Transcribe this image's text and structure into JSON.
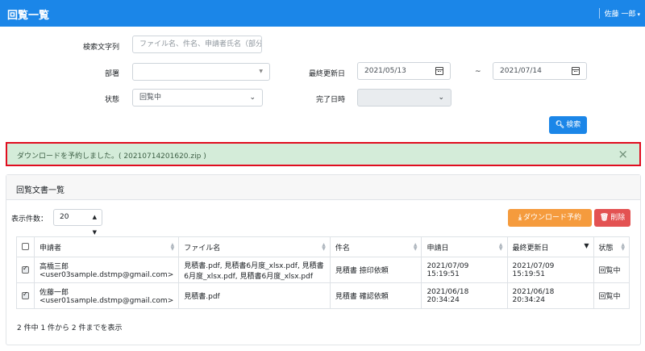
{
  "header": {
    "title": "回覧一覧",
    "user": "佐藤 一郎",
    "user_caret": "▾"
  },
  "search": {
    "keyword_label": "検索文字列",
    "keyword_placeholder": "ファイル名、件名、申請者氏名（部分",
    "dept_label": "部署",
    "dept_value": "",
    "last_updated_label": "最終更新日",
    "date_from": "2021/05/13",
    "date_sep": "~",
    "date_to": "2021/07/14",
    "status_label": "状態",
    "status_value": "回覧中",
    "completed_label": "完了日時",
    "completed_value": "",
    "search_button": "検索",
    "search_icon": "search-icon"
  },
  "alert": {
    "message": "ダウンロードを予約しました。( 20210714201620.zip )",
    "close": "×"
  },
  "list": {
    "title": "回覧文書一覧",
    "per_page_label": "表示件数：",
    "per_page_value": "20",
    "download_button": "ダウンロード予約",
    "delete_button": "削除",
    "columns": [
      "",
      "申請者",
      "ファイル名",
      "件名",
      "申請日",
      "最終更新日",
      "状態"
    ],
    "rows": [
      {
        "checked": true,
        "applicant_name": "高橋三郎",
        "applicant_email": "<user03sample.dstmp@gmail.com>",
        "file": "見積書.pdf, 見積書6月度_xlsx.pdf, 見積書6月度_xlsx.pdf, 見積書6月度_xlsx.pdf",
        "subject": "見積書 捺印依頼",
        "applied": "2021/07/09 15:19:51",
        "updated": "2021/07/09 15:19:51",
        "status": "回覧中"
      },
      {
        "checked": true,
        "applicant_name": "佐藤一郎",
        "applicant_email": "<user01sample.dstmp@gmail.com>",
        "file": "見積書.pdf",
        "subject": "見積書 確認依頼",
        "applied": "2021/06/18 20:34:24",
        "updated": "2021/06/18 20:34:24",
        "status": "回覧中"
      }
    ],
    "footer": "2 件中 1 件から 2 件までを表示"
  },
  "colors": {
    "primary": "#1b86e8",
    "warning": "#f59b3d",
    "danger": "#e35252",
    "alert_bg": "#d4ecd9",
    "highlight": "#e00d1f"
  }
}
